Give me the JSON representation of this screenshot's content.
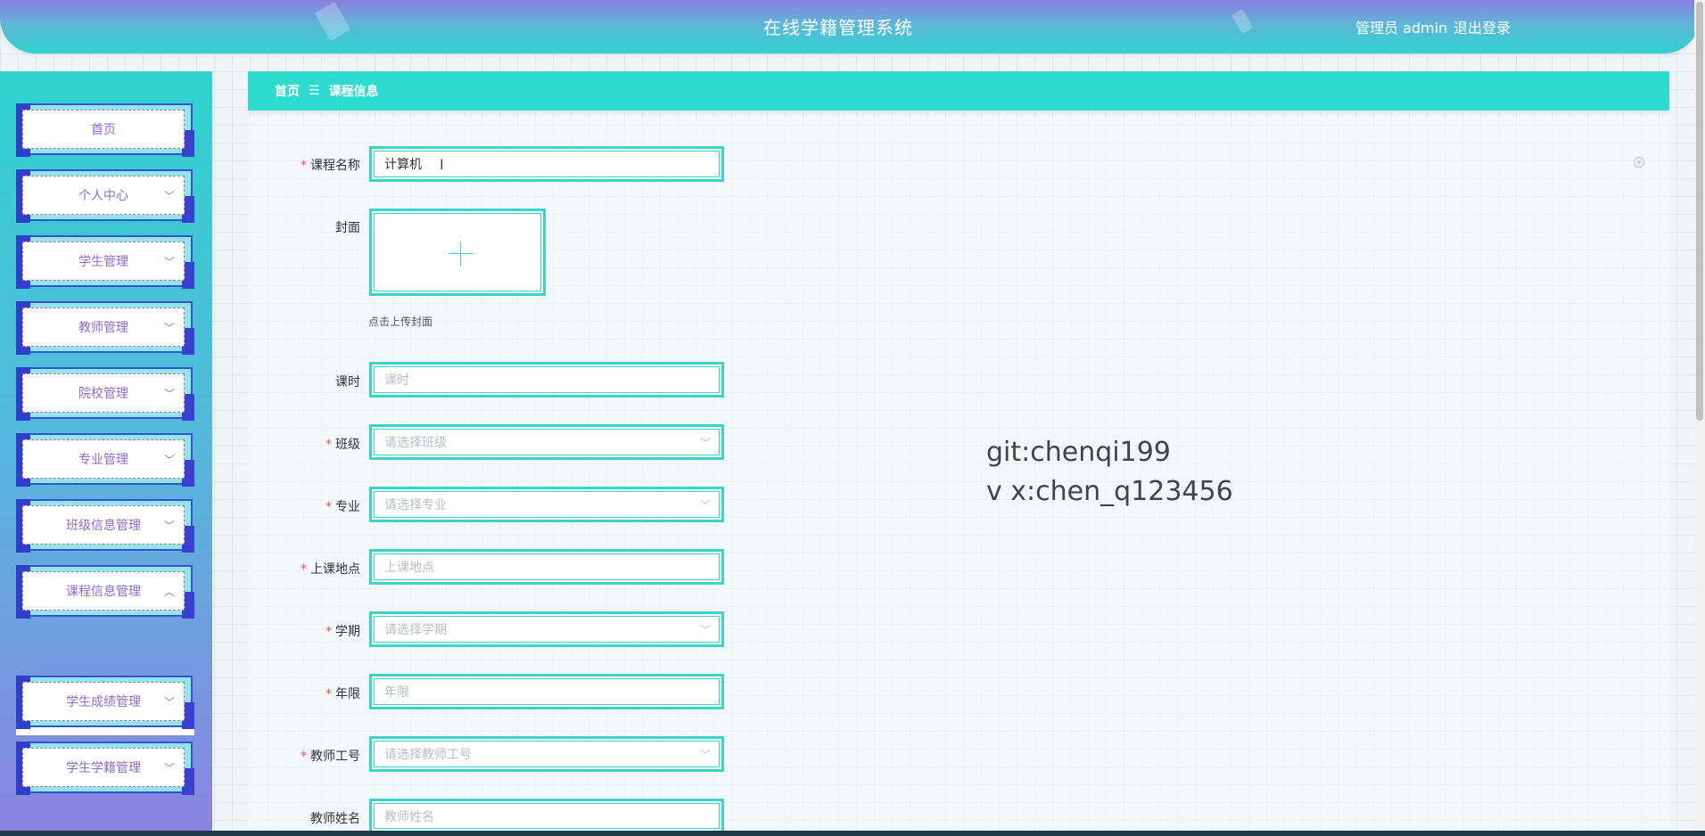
{
  "app": {
    "title": "在线学籍管理系统",
    "user": "管理员 admin",
    "logout": "退出登录"
  },
  "breadcrumb": {
    "home": "首页",
    "separator": "☰",
    "current": "课程信息"
  },
  "sidebar": {
    "items": [
      {
        "label": "首页",
        "chevron": ""
      },
      {
        "label": "个人中心",
        "chevron": "﹀"
      },
      {
        "label": "学生管理",
        "chevron": "﹀"
      },
      {
        "label": "教师管理",
        "chevron": "﹀"
      },
      {
        "label": "院校管理",
        "chevron": "﹀"
      },
      {
        "label": "专业管理",
        "chevron": "﹀"
      },
      {
        "label": "班级信息管理",
        "chevron": "﹀"
      },
      {
        "label": "课程信息管理",
        "chevron": "︿"
      },
      {
        "label": "学生成绩管理",
        "chevron": "﹀"
      },
      {
        "label": "学生学籍管理",
        "chevron": "﹀"
      }
    ],
    "active_submenu": "课程信息"
  },
  "form": {
    "course_name": {
      "label": "课程名称",
      "required": "*",
      "value": "计算机"
    },
    "cover": {
      "label": "封面",
      "tip": "点击上传封面"
    },
    "hours": {
      "label": "课时",
      "placeholder": "课时"
    },
    "class": {
      "label": "班级",
      "required": "*",
      "placeholder": "请选择班级"
    },
    "major": {
      "label": "专业",
      "required": "*",
      "placeholder": "请选择专业"
    },
    "location": {
      "label": "上课地点",
      "required": "*",
      "placeholder": "上课地点"
    },
    "semester": {
      "label": "学期",
      "required": "*",
      "placeholder": "请选择学期"
    },
    "years": {
      "label": "年限",
      "required": "*",
      "placeholder": "年限"
    },
    "teacher_id": {
      "label": "教师工号",
      "required": "*",
      "placeholder": "请选择教师工号"
    },
    "teacher_name": {
      "label": "教师姓名",
      "placeholder": "教师姓名"
    }
  },
  "watermark": {
    "line1": "git:chenqi199",
    "line2": "v x:chen_q123456"
  },
  "colors": {
    "accent": "#2edbcf",
    "header_top": "#8a7fe0",
    "menu_text": "#8a6bd0",
    "required": "#ff4949"
  },
  "icons": {
    "select_caret": "chevron-down-icon",
    "upload": "plus-icon",
    "clear": "close-circle-icon"
  }
}
